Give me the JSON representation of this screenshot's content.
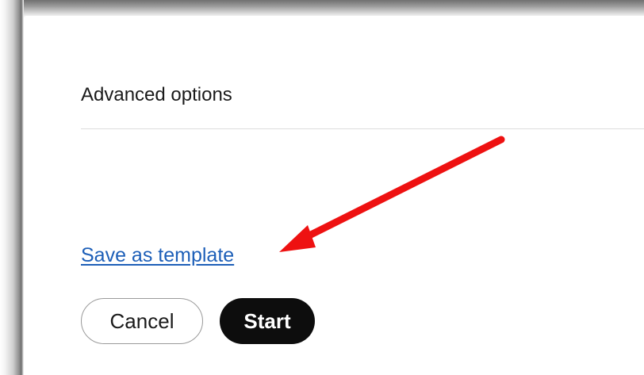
{
  "advanced_options": {
    "title": "Advanced options"
  },
  "actions": {
    "save_template_link": "Save as template",
    "cancel_label": "Cancel",
    "start_label": "Start"
  },
  "colors": {
    "link": "#1d5fb8",
    "primary_button": "#0d0d0d",
    "annotation_arrow": "#ee1111"
  },
  "annotation": {
    "icon": "red-arrow-pointing-to-save-as-template"
  }
}
